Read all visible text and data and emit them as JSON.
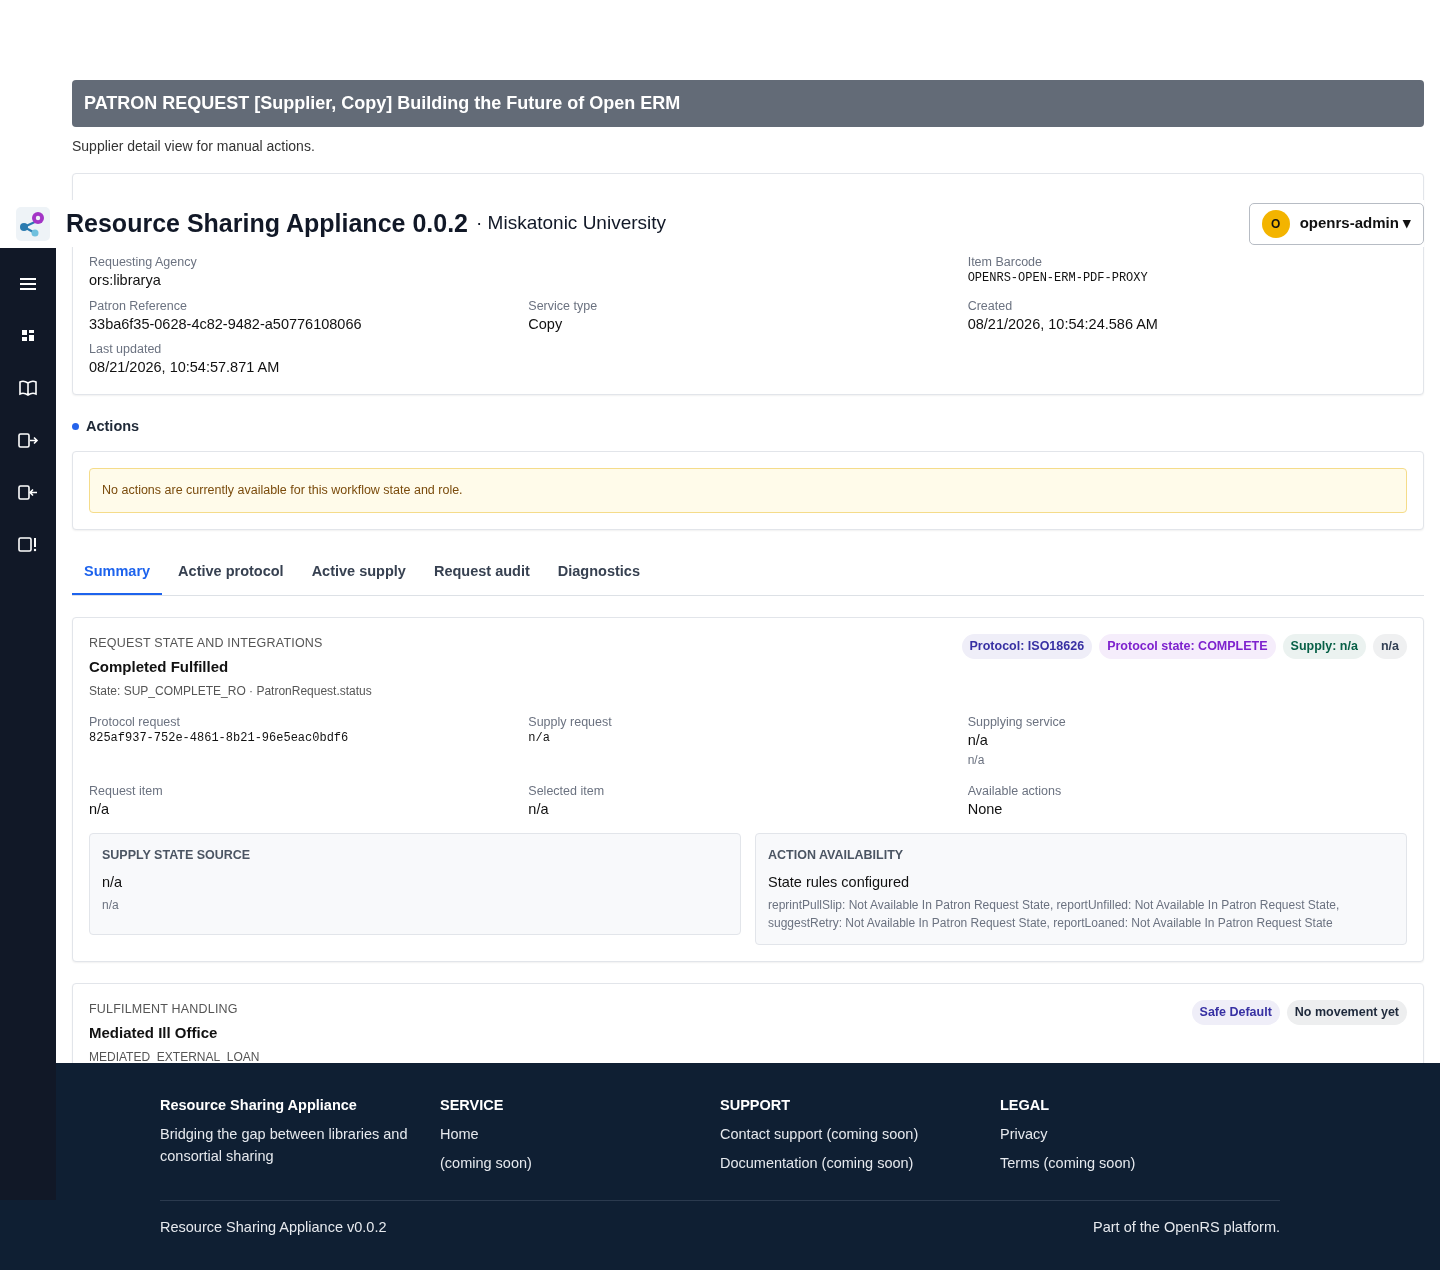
{
  "page": {
    "title": "PATRON REQUEST [Supplier, Copy] Building the Future of Open ERM",
    "subtitle": "Supplier detail view for manual actions."
  },
  "app_header": {
    "title": "Resource Sharing Appliance 0.0.2",
    "org": "· Miskatonic University",
    "user": {
      "initial": "O",
      "name": "openrs-admin",
      "caret": "▾"
    }
  },
  "request_header": {
    "rows": [
      [
        {
          "label": "Requesting Agency",
          "value": "ors:librarya",
          "kind": "text"
        },
        null,
        {
          "label": "Item Barcode",
          "value": "OPENRS-OPEN-ERM-PDF-PROXY",
          "kind": "code"
        }
      ],
      [
        {
          "label": "Patron Reference",
          "value": "33ba6f35-0628-4c82-9482-a50776108066",
          "kind": "text"
        },
        {
          "label": "Service type",
          "value": "Copy",
          "kind": "text"
        },
        {
          "label": "Created",
          "value": "08/21/2026, 10:54:24.586 AM",
          "kind": "text"
        }
      ],
      [
        {
          "label": "Last updated",
          "value": "08/21/2026, 10:54:57.871 AM",
          "kind": "text"
        },
        null,
        null
      ]
    ]
  },
  "actions": {
    "heading": "Actions",
    "message": "No actions are currently available for this workflow state and role."
  },
  "tabs": [
    {
      "label": "Summary",
      "selected": true
    },
    {
      "label": "Active protocol",
      "selected": false
    },
    {
      "label": "Active supply",
      "selected": false
    },
    {
      "label": "Request audit",
      "selected": false
    },
    {
      "label": "Diagnostics",
      "selected": false
    }
  ],
  "state_card": {
    "label": "REQUEST STATE AND INTEGRATIONS",
    "title": "Completed Fulfilled",
    "subtitle": "State: SUP_COMPLETE_RO · PatronRequest.status",
    "badges": [
      {
        "text": "Protocol: ISO18626",
        "color": "#3730a3"
      },
      {
        "text": "Protocol state: COMPLETE",
        "color": "#7e22ce"
      },
      {
        "text": "Supply: n/a",
        "color": "#065f46"
      },
      {
        "text": "n/a",
        "color": "#334155"
      }
    ],
    "rows": [
      [
        {
          "label": "Protocol request",
          "value": "825af937-752e-4861-8b21-96e5eac0bdf6",
          "kind": "code"
        },
        {
          "label": "Supply request",
          "value": "n/a",
          "kind": "code"
        },
        {
          "label": "Supplying service",
          "value": "n/a",
          "note": "n/a",
          "kind": "text"
        }
      ],
      [
        {
          "label": "Request item",
          "value": "n/a",
          "kind": "text"
        },
        {
          "label": "Selected item",
          "value": "n/a",
          "kind": "text"
        },
        {
          "label": "Available actions",
          "value": "None",
          "kind": "text"
        }
      ]
    ],
    "panels": [
      {
        "label": "SUPPLY STATE SOURCE",
        "title": "n/a",
        "detail": "n/a"
      },
      {
        "label": "ACTION AVAILABILITY",
        "title": "State rules configured",
        "detail": "reprintPullSlip: Not Available In Patron Request State, reportUnfilled: Not Available In Patron Request State, suggestRetry: Not Available In Patron Request State, reportLoaned: Not Available In Patron Request State"
      }
    ]
  },
  "fulfilment_card": {
    "label": "FULFILMENT HANDLING",
    "title": "Mediated Ill Office",
    "code": "MEDIATED_EXTERNAL_LOAN",
    "badges": [
      {
        "text": "Safe Default",
        "color": "#3730a3"
      },
      {
        "text": "No movement yet",
        "color": "#1e293b"
      }
    ]
  },
  "footer": {
    "brand": "Resource Sharing Appliance",
    "tagline": "Bridging the gap between libraries and consortial sharing",
    "columns": [
      {
        "heading": "SERVICE",
        "links": [
          "Home",
          "(coming soon)"
        ]
      },
      {
        "heading": "SUPPORT",
        "links": [
          "Contact support (coming soon)",
          "Documentation (coming soon)"
        ]
      },
      {
        "heading": "LEGAL",
        "links": [
          "Privacy",
          "Terms (coming soon)"
        ]
      }
    ],
    "bottom_left": "Resource Sharing Appliance v0.0.2",
    "bottom_right": "Part of the OpenRS platform."
  }
}
